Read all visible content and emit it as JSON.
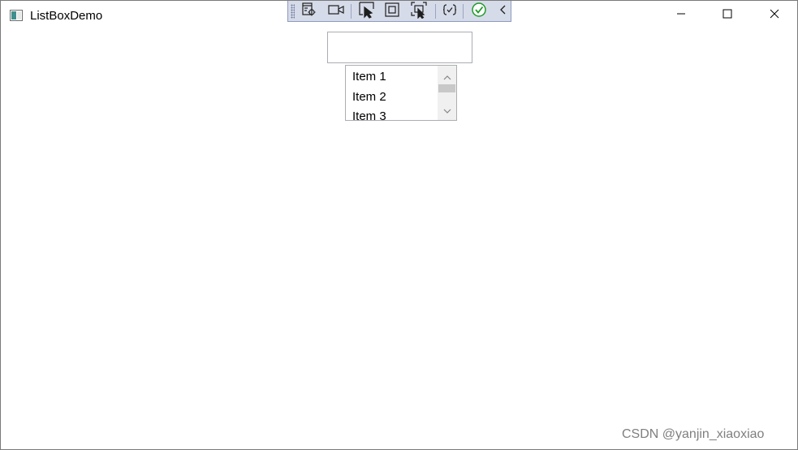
{
  "window": {
    "title": "ListBoxDemo",
    "app_icon": "window-app-icon",
    "controls": {
      "minimize_icon": "minimize-icon",
      "maximize_icon": "maximize-icon",
      "close_icon": "close-icon"
    }
  },
  "debug_toolbar": {
    "buttons": [
      {
        "name": "live-visual-tree",
        "icon": "visual-tree-icon"
      },
      {
        "name": "record",
        "icon": "video-camera-icon"
      },
      {
        "name": "select-element",
        "icon": "select-pointer-icon"
      },
      {
        "name": "display-layout-adorners",
        "icon": "layout-adorner-icon"
      },
      {
        "name": "track-focused-element",
        "icon": "track-focus-icon"
      },
      {
        "name": "hot-reload",
        "icon": "hot-reload-icon"
      },
      {
        "name": "binding-status",
        "icon": "check-circle-icon"
      },
      {
        "name": "collapse-toolbar",
        "icon": "chevron-left-icon"
      }
    ]
  },
  "textbox": {
    "value": "",
    "placeholder": ""
  },
  "listbox": {
    "items": [
      "Item 1",
      "Item 2",
      "Item 3"
    ],
    "scroll_position": 0.1
  },
  "watermark": "CSDN @yanjin_xiaoxiao",
  "colors": {
    "toolbar_bg": "#d6dbe9",
    "toolbar_icon": "#1e1e1e",
    "toolbar_check": "#1d9a2a",
    "border": "#abadb3"
  }
}
